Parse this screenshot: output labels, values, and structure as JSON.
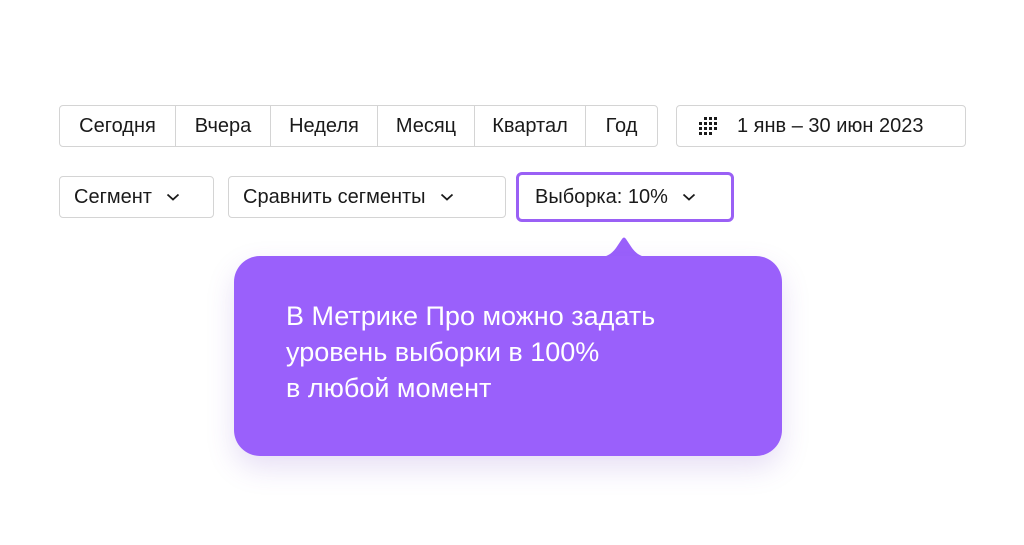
{
  "period": {
    "buttons": [
      {
        "label": "Сегодня"
      },
      {
        "label": "Вчера"
      },
      {
        "label": "Неделя"
      },
      {
        "label": "Месяц"
      },
      {
        "label": "Квартал"
      },
      {
        "label": "Год"
      }
    ]
  },
  "date_range": {
    "icon": "calendar-icon",
    "label": "1 янв – 30 июн 2023"
  },
  "filters": {
    "segment_label": "Сегмент",
    "compare_label": "Сравнить сегменты",
    "sample_label": "Выборка: 10%",
    "chevron_icon": "chevron-down-icon"
  },
  "tooltip": {
    "lines": [
      "В Метрике Про можно задать",
      "уровень выборки в 100%",
      "в любой момент"
    ]
  },
  "colors": {
    "accent": "#9a60fb",
    "border": "#d4d4d4",
    "text": "#1a1a1a"
  }
}
